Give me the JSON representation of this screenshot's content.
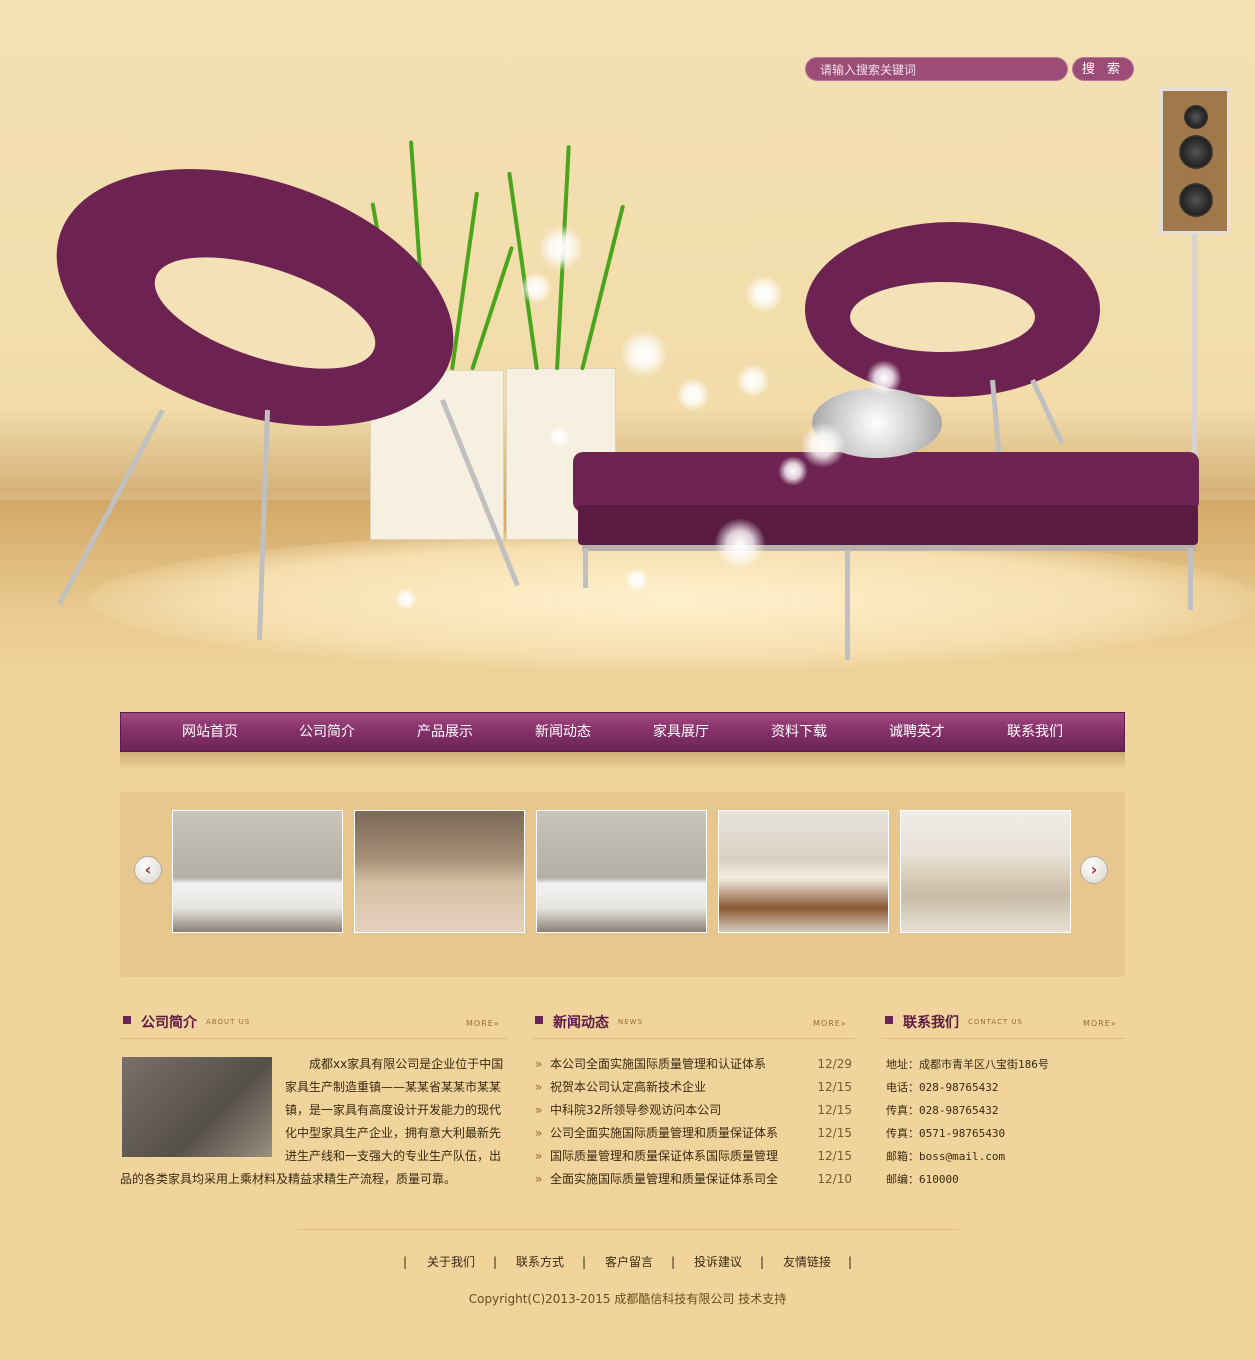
{
  "search": {
    "placeholder": "请输入搜索关键词",
    "button_label": "搜 索"
  },
  "nav": {
    "items": [
      {
        "label": "网站首页"
      },
      {
        "label": "公司简介"
      },
      {
        "label": "产品展示"
      },
      {
        "label": "新闻动态"
      },
      {
        "label": "家具展厅"
      },
      {
        "label": "资料下载"
      },
      {
        "label": "诚聘英才"
      },
      {
        "label": "联系我们"
      }
    ]
  },
  "slider": {
    "prev_icon": "chevron-left-icon",
    "next_icon": "chevron-right-icon",
    "thumbnails": [
      {
        "name": "bedroom-white-headboard"
      },
      {
        "name": "bedroom-tufted-headboard"
      },
      {
        "name": "bedroom-white-headboard"
      },
      {
        "name": "wooden-bed"
      },
      {
        "name": "living-room-sofa"
      }
    ]
  },
  "about": {
    "title": "公司简介",
    "subtitle_en": "ABOUT US",
    "more": "MORE»",
    "text": "成都xx家具有限公司是企业位于中国家具生产制造重镇——某某省某某市某某镇，是一家具有高度设计开发能力的现代化中型家具生产企业，拥有意大利最新先进生产线和一支强大的专业生产队伍，出品的各类家具均采用上乘材料及精益求精生产流程，质量可靠。"
  },
  "news": {
    "title": "新闻动态",
    "subtitle_en": "NEWS",
    "more": "MORE»",
    "items": [
      {
        "title": "本公司全面实施国际质量管理和认证体系",
        "date": "12/29"
      },
      {
        "title": "祝贺本公司认定高新技术企业",
        "date": "12/15"
      },
      {
        "title": "中科院32所领导参观访问本公司",
        "date": "12/15"
      },
      {
        "title": "公司全面实施国际质量管理和质量保证体系",
        "date": "12/15"
      },
      {
        "title": "国际质量管理和质量保证体系国际质量管理",
        "date": "12/15"
      },
      {
        "title": "全面实施国际质量管理和质量保证体系司全",
        "date": "12/10"
      }
    ]
  },
  "contact": {
    "title": "联系我们",
    "subtitle_en": "CONTACT US",
    "more": "MORE»",
    "rows": [
      "地址：成都市青羊区八宝街186号",
      "电话：028-98765432",
      "传真：028-98765432",
      "传真：0571-98765430",
      "邮箱：boss@mail.com",
      "邮编：610000"
    ]
  },
  "footer": {
    "links": [
      "关于我们",
      "联系方式",
      "客户留言",
      "投诉建议",
      "友情链接"
    ],
    "copyright": "Copyright(C)2013-2015 成都酷信科技有限公司 技术支持"
  },
  "colors": {
    "brand": "#86326a",
    "background": "#f0d49c",
    "accent": "#6b2456"
  }
}
